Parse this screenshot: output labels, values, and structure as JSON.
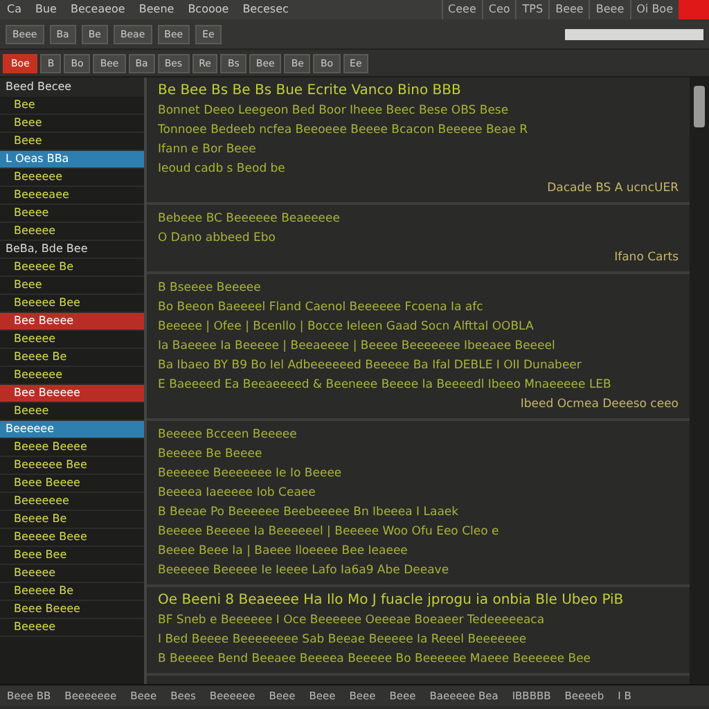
{
  "menu": [
    "Ca",
    "Bue",
    "Beceaeoe",
    "Beene",
    "Bcoooe",
    "Becesec"
  ],
  "title_tabs": [
    "Ceee",
    "Ceo",
    "TPS",
    "Beee",
    "Beee",
    "Oi Boe"
  ],
  "toolbar": [
    "Beee",
    "Ba",
    "Be",
    "Beae",
    "Bee",
    "Ee"
  ],
  "toolbar2": [
    "Boe",
    "B",
    "Bo",
    "Bee",
    "Ba",
    "Bes",
    "Re",
    "Bs",
    "Bee",
    "Be",
    "Bo",
    "Ee"
  ],
  "sidebar": {
    "title": "Beed Becee",
    "items": [
      {
        "text": "Bee",
        "selected": false,
        "kind": "item"
      },
      {
        "text": "Beee",
        "selected": false,
        "kind": "item"
      },
      {
        "text": "Beee",
        "selected": false,
        "kind": "item"
      },
      {
        "text": "L Oeas BBa",
        "selected": true,
        "kind": "heading"
      },
      {
        "text": "Beeeeee",
        "selected": false,
        "kind": "item"
      },
      {
        "text": "Beeeeaee",
        "selected": false,
        "kind": "item"
      },
      {
        "text": "Beeee",
        "selected": false,
        "kind": "item"
      },
      {
        "text": "Beeeee",
        "selected": false,
        "kind": "item"
      },
      {
        "text": "BeBa, Bde Bee",
        "selected": false,
        "kind": "heading"
      },
      {
        "text": "Beeeee Be",
        "selected": false,
        "kind": "item"
      },
      {
        "text": "Beee",
        "selected": false,
        "kind": "item"
      },
      {
        "text": "Beeeee Bee",
        "selected": false,
        "kind": "item"
      },
      {
        "text": "Bee Beeee",
        "selected": false,
        "kind": "alert"
      },
      {
        "text": "Beeeee",
        "selected": false,
        "kind": "item"
      },
      {
        "text": "Beeee Be",
        "selected": false,
        "kind": "item"
      },
      {
        "text": "Beeeeee",
        "selected": false,
        "kind": "item"
      },
      {
        "text": "Bee Beeeee",
        "selected": false,
        "kind": "alert"
      },
      {
        "text": "Beeee",
        "selected": false,
        "kind": "item"
      },
      {
        "text": "Beeeeee",
        "selected": true,
        "kind": "heading"
      },
      {
        "text": "Beeee Beeee",
        "selected": false,
        "kind": "item"
      },
      {
        "text": "Beeeeee Bee",
        "selected": false,
        "kind": "item"
      },
      {
        "text": "Beee Beeee",
        "selected": false,
        "kind": "item"
      },
      {
        "text": "Beeeeeee",
        "selected": false,
        "kind": "item"
      },
      {
        "text": "Beeee Be",
        "selected": false,
        "kind": "item"
      },
      {
        "text": "Beeeee Beee",
        "selected": false,
        "kind": "item"
      },
      {
        "text": "Beee Bee",
        "selected": false,
        "kind": "item"
      },
      {
        "text": "Beeeee",
        "selected": false,
        "kind": "item"
      },
      {
        "text": "Beeeee Be",
        "selected": false,
        "kind": "item"
      },
      {
        "text": "Beee Beeee",
        "selected": false,
        "kind": "item"
      },
      {
        "text": "Beeeee",
        "selected": false,
        "kind": "item"
      }
    ]
  },
  "editor": {
    "sections": [
      {
        "lines": [
          {
            "text": "Be Bee Bs Be Bs Bue Ecrite Vanco Bino BBB",
            "kind": "heading"
          },
          {
            "text": "Bonnet Deeo Leegeon Bed Boor Iheee Beec Bese OBS Bese",
            "kind": "code"
          },
          {
            "text": "Tonnoee Bedeeb ncfea Beeoeee Beeee Bcacon Beeeee Beae R",
            "kind": "code"
          },
          {
            "text": "Ifann e Bor Beee",
            "kind": "code"
          },
          {
            "text": "Ieoud cadb s Beod be",
            "kind": "code"
          },
          {
            "text": "Dacade BS A ucncUER",
            "kind": "note"
          }
        ]
      },
      {
        "lines": [
          {
            "text": "Bebeee BC Beeeeee Beaeeeee",
            "kind": "code"
          },
          {
            "text": "O Dano abbeed Ebo",
            "kind": "code"
          },
          {
            "text": "Ifano Carts",
            "kind": "note"
          }
        ]
      },
      {
        "lines": [
          {
            "text": "B Bseeee Beeeee",
            "kind": "code"
          },
          {
            "text": "Bo Beeon Baeeeel Fland Caenol Beeeeee Fcoena Ia afc",
            "kind": "code"
          },
          {
            "text": "Beeeee | Ofee | Bcenllo | Bocce Ieleen Gaad Socn Alfttal OOBLA",
            "kind": "code"
          },
          {
            "text": "Ia Baeeee Ia Beeeee | Beeaeeee | Beeee Beeeeeee Ibeeaee Beeeel",
            "kind": "code"
          },
          {
            "text": "Ba Ibaeo BY B9 Bo Iel Adbeeeeeed Beeeee Ba Ifal DEBLE I OII Dunabeer",
            "kind": "code"
          },
          {
            "text": "E Baeeeed Ea Beeaeeeed & Beeneee Beeee Ia Beeeedl Ibeeo Mnaeeeee LEB",
            "kind": "code"
          },
          {
            "text": "Ibeed Ocmea Deeeso ceeo",
            "kind": "note"
          }
        ]
      },
      {
        "lines": [
          {
            "text": "Beeeee Bcceen Beeeee",
            "kind": "code"
          },
          {
            "text": "Beeeee Be Beeee",
            "kind": "code"
          },
          {
            "text": "Beeeeee Beeeeeee Ie Io Beeee",
            "kind": "code"
          },
          {
            "text": "Beeeea Iaeeeee Iob Ceaee",
            "kind": "code"
          },
          {
            "text": "B Beeae Po Beeeeee Beebeeeee Bn Ibeeea I Laaek",
            "kind": "code"
          },
          {
            "text": "Beeeee Beeeee Ia Beeeeeel | Beeeee Woo Ofu Eeo Cleo e",
            "kind": "code"
          },
          {
            "text": "Beeee Beee Ia | Baeee Iloeeee Bee Ieaeee",
            "kind": "code"
          },
          {
            "text": "Beeeeee Beeeee Ie Ieeee Lafo Ia6a9 Abe Deeave",
            "kind": "code"
          }
        ]
      },
      {
        "lines": [
          {
            "text": "Oe Beeni 8 Beaeeee Ha Ilo Mo J fuacle jprogu ia onbia Ble Ubeo PiB",
            "kind": "heading"
          },
          {
            "text": "BF Sneb e Beeeeee I Oce Beeeeee Oeeeae Boeaeer Tedeeeeeaca",
            "kind": "code"
          },
          {
            "text": "I Bed Beeee Beeeeeeee Sab Beeae Beeeee Ia Reeel Beeeeeee",
            "kind": "code"
          },
          {
            "text": "B Beeeee Bend Beeaee Beeeea Beeeee Bo Beeeeee Maeee Beeeeee Bee",
            "kind": "code"
          }
        ]
      }
    ]
  },
  "status_bar": [
    "Beee BB",
    "Beeeeeee",
    "Beee",
    "Bees",
    "Beeeeee",
    "Beee",
    "Beee",
    "Beee",
    "Beee",
    "Baeeeee Bea",
    "IBBBBB",
    "Beeeeb",
    "I B"
  ]
}
